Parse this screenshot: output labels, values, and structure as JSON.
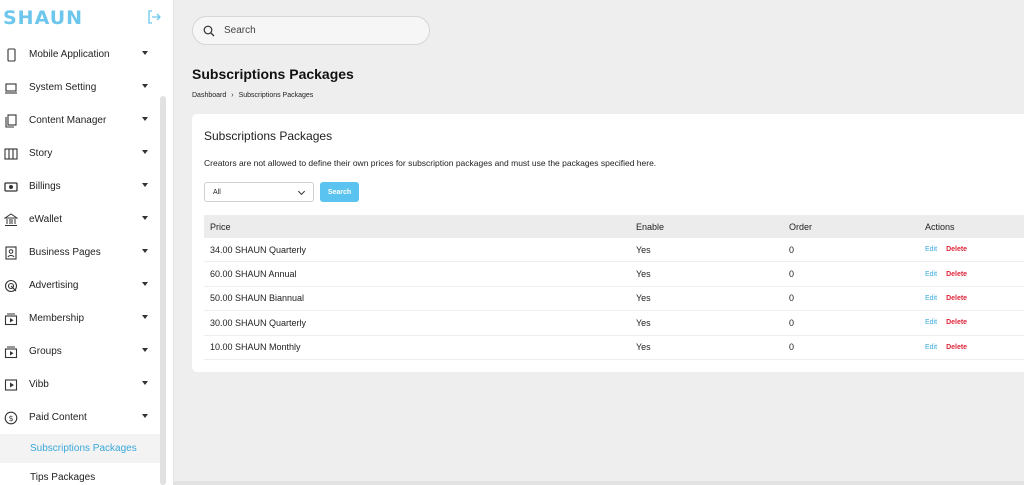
{
  "brand": {
    "logo_text": "SHAUN",
    "accent": "#6dc6ec"
  },
  "sidebar": {
    "items": [
      {
        "label": "Mobile Application",
        "icon": "mobile-icon"
      },
      {
        "label": "System Setting",
        "icon": "laptop-icon"
      },
      {
        "label": "Content Manager",
        "icon": "pages-icon"
      },
      {
        "label": "Story",
        "icon": "columns-icon"
      },
      {
        "label": "Billings",
        "icon": "cash-icon"
      },
      {
        "label": "eWallet",
        "icon": "bank-icon"
      },
      {
        "label": "Business Pages",
        "icon": "contact-card-icon"
      },
      {
        "label": "Advertising",
        "icon": "target-icon"
      },
      {
        "label": "Membership",
        "icon": "play-stack-icon"
      },
      {
        "label": "Groups",
        "icon": "play-stack-icon"
      },
      {
        "label": "Vibb",
        "icon": "play-box-icon"
      },
      {
        "label": "Paid Content",
        "icon": "dollar-circle-icon"
      }
    ],
    "sub_items": [
      {
        "label": "Subscriptions Packages",
        "active": true
      },
      {
        "label": "Tips Packages",
        "active": false
      }
    ]
  },
  "header": {
    "search_label": "Search"
  },
  "page": {
    "title": "Subscriptions Packages",
    "breadcrumb": [
      "Dashboard",
      "Subscriptions Packages"
    ]
  },
  "card": {
    "title": "Subscriptions Packages",
    "description": "Creators are not allowed to define their own prices for subscription packages and must use the packages specified here.",
    "filter_value": "All",
    "search_button": "Search"
  },
  "table": {
    "columns": [
      "Price",
      "Enable",
      "Order",
      "Actions"
    ],
    "rows": [
      {
        "price": "34.00 SHAUN Quarterly",
        "enable": "Yes",
        "order": "0"
      },
      {
        "price": "60.00 SHAUN Annual",
        "enable": "Yes",
        "order": "0"
      },
      {
        "price": "50.00 SHAUN Biannual",
        "enable": "Yes",
        "order": "0"
      },
      {
        "price": "30.00 SHAUN Quarterly",
        "enable": "Yes",
        "order": "0"
      },
      {
        "price": "10.00 SHAUN Monthly",
        "enable": "Yes",
        "order": "0"
      }
    ],
    "edit_label": "Edit",
    "delete_label": "Delete"
  }
}
